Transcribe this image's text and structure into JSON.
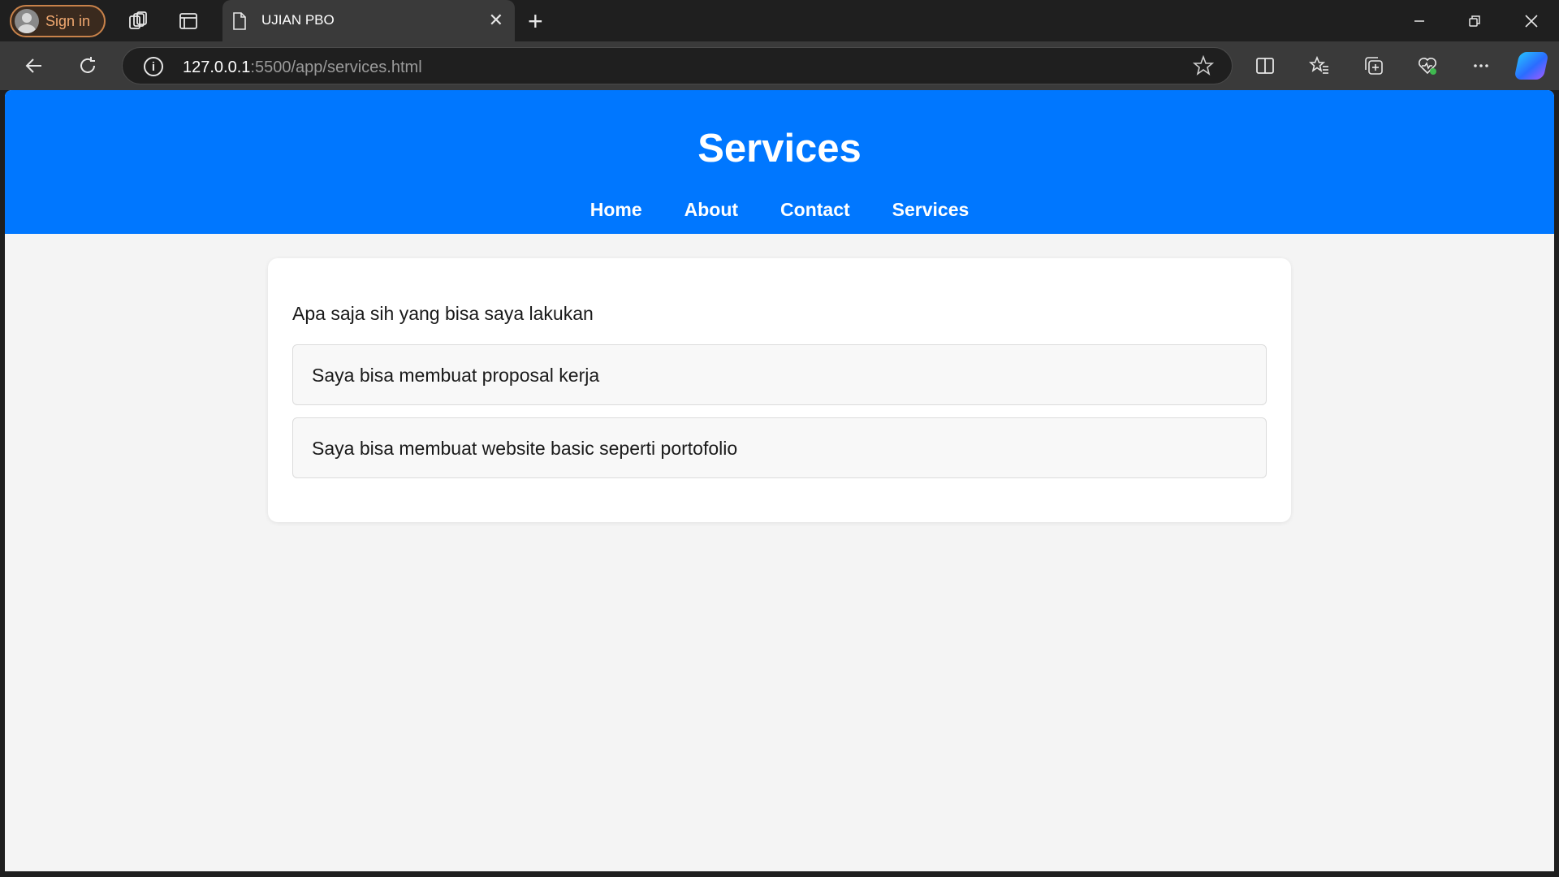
{
  "browser": {
    "signin_label": "Sign in",
    "tab": {
      "title": "UJIAN PBO"
    },
    "address": {
      "host": "127.0.0.1",
      "path": ":5500/app/services.html"
    },
    "icons": {
      "workspaces": "workspaces-icon",
      "tab_actions": "tab-actions-icon",
      "new_tab": "plus-icon",
      "back": "back-arrow-icon",
      "refresh": "refresh-icon",
      "info": "info-icon",
      "favorite": "star-icon",
      "split": "split-screen-icon",
      "favorites": "favorites-icon",
      "collections": "collections-icon",
      "health": "browser-essentials-icon",
      "more": "more-icon",
      "copilot": "copilot-icon"
    }
  },
  "page": {
    "header": {
      "title": "Services",
      "nav": [
        "Home",
        "About",
        "Contact",
        "Services"
      ],
      "background": "#0077ff"
    },
    "content": {
      "intro": "Apa saja sih yang bisa saya lakukan",
      "services": [
        "Saya bisa membuat proposal kerja",
        "Saya bisa membuat website basic seperti portofolio"
      ]
    }
  }
}
